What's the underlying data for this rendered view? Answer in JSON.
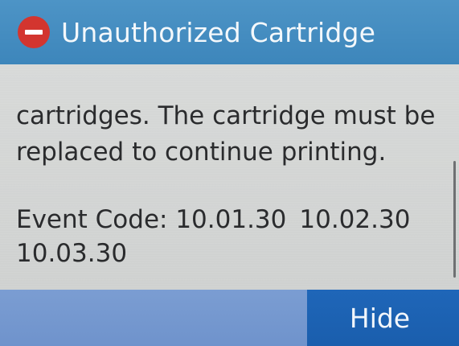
{
  "header": {
    "icon": "error-icon",
    "title": "Unauthorized Cartridge"
  },
  "message": {
    "line1": "cartridges. The cartridge must be",
    "line2": "replaced to continue printing."
  },
  "event": {
    "label": "Event Code: 10.01.30",
    "code2": "10.02.30",
    "code3": "10.03.30"
  },
  "footer": {
    "hide_label": "Hide"
  },
  "colors": {
    "header": "#3d86bb",
    "error_icon": "#d3352f",
    "button": "#1a5ead",
    "footer_bar": "#7098cf",
    "content_bg": "#d2d4d3",
    "text": "#2a2b2d"
  }
}
